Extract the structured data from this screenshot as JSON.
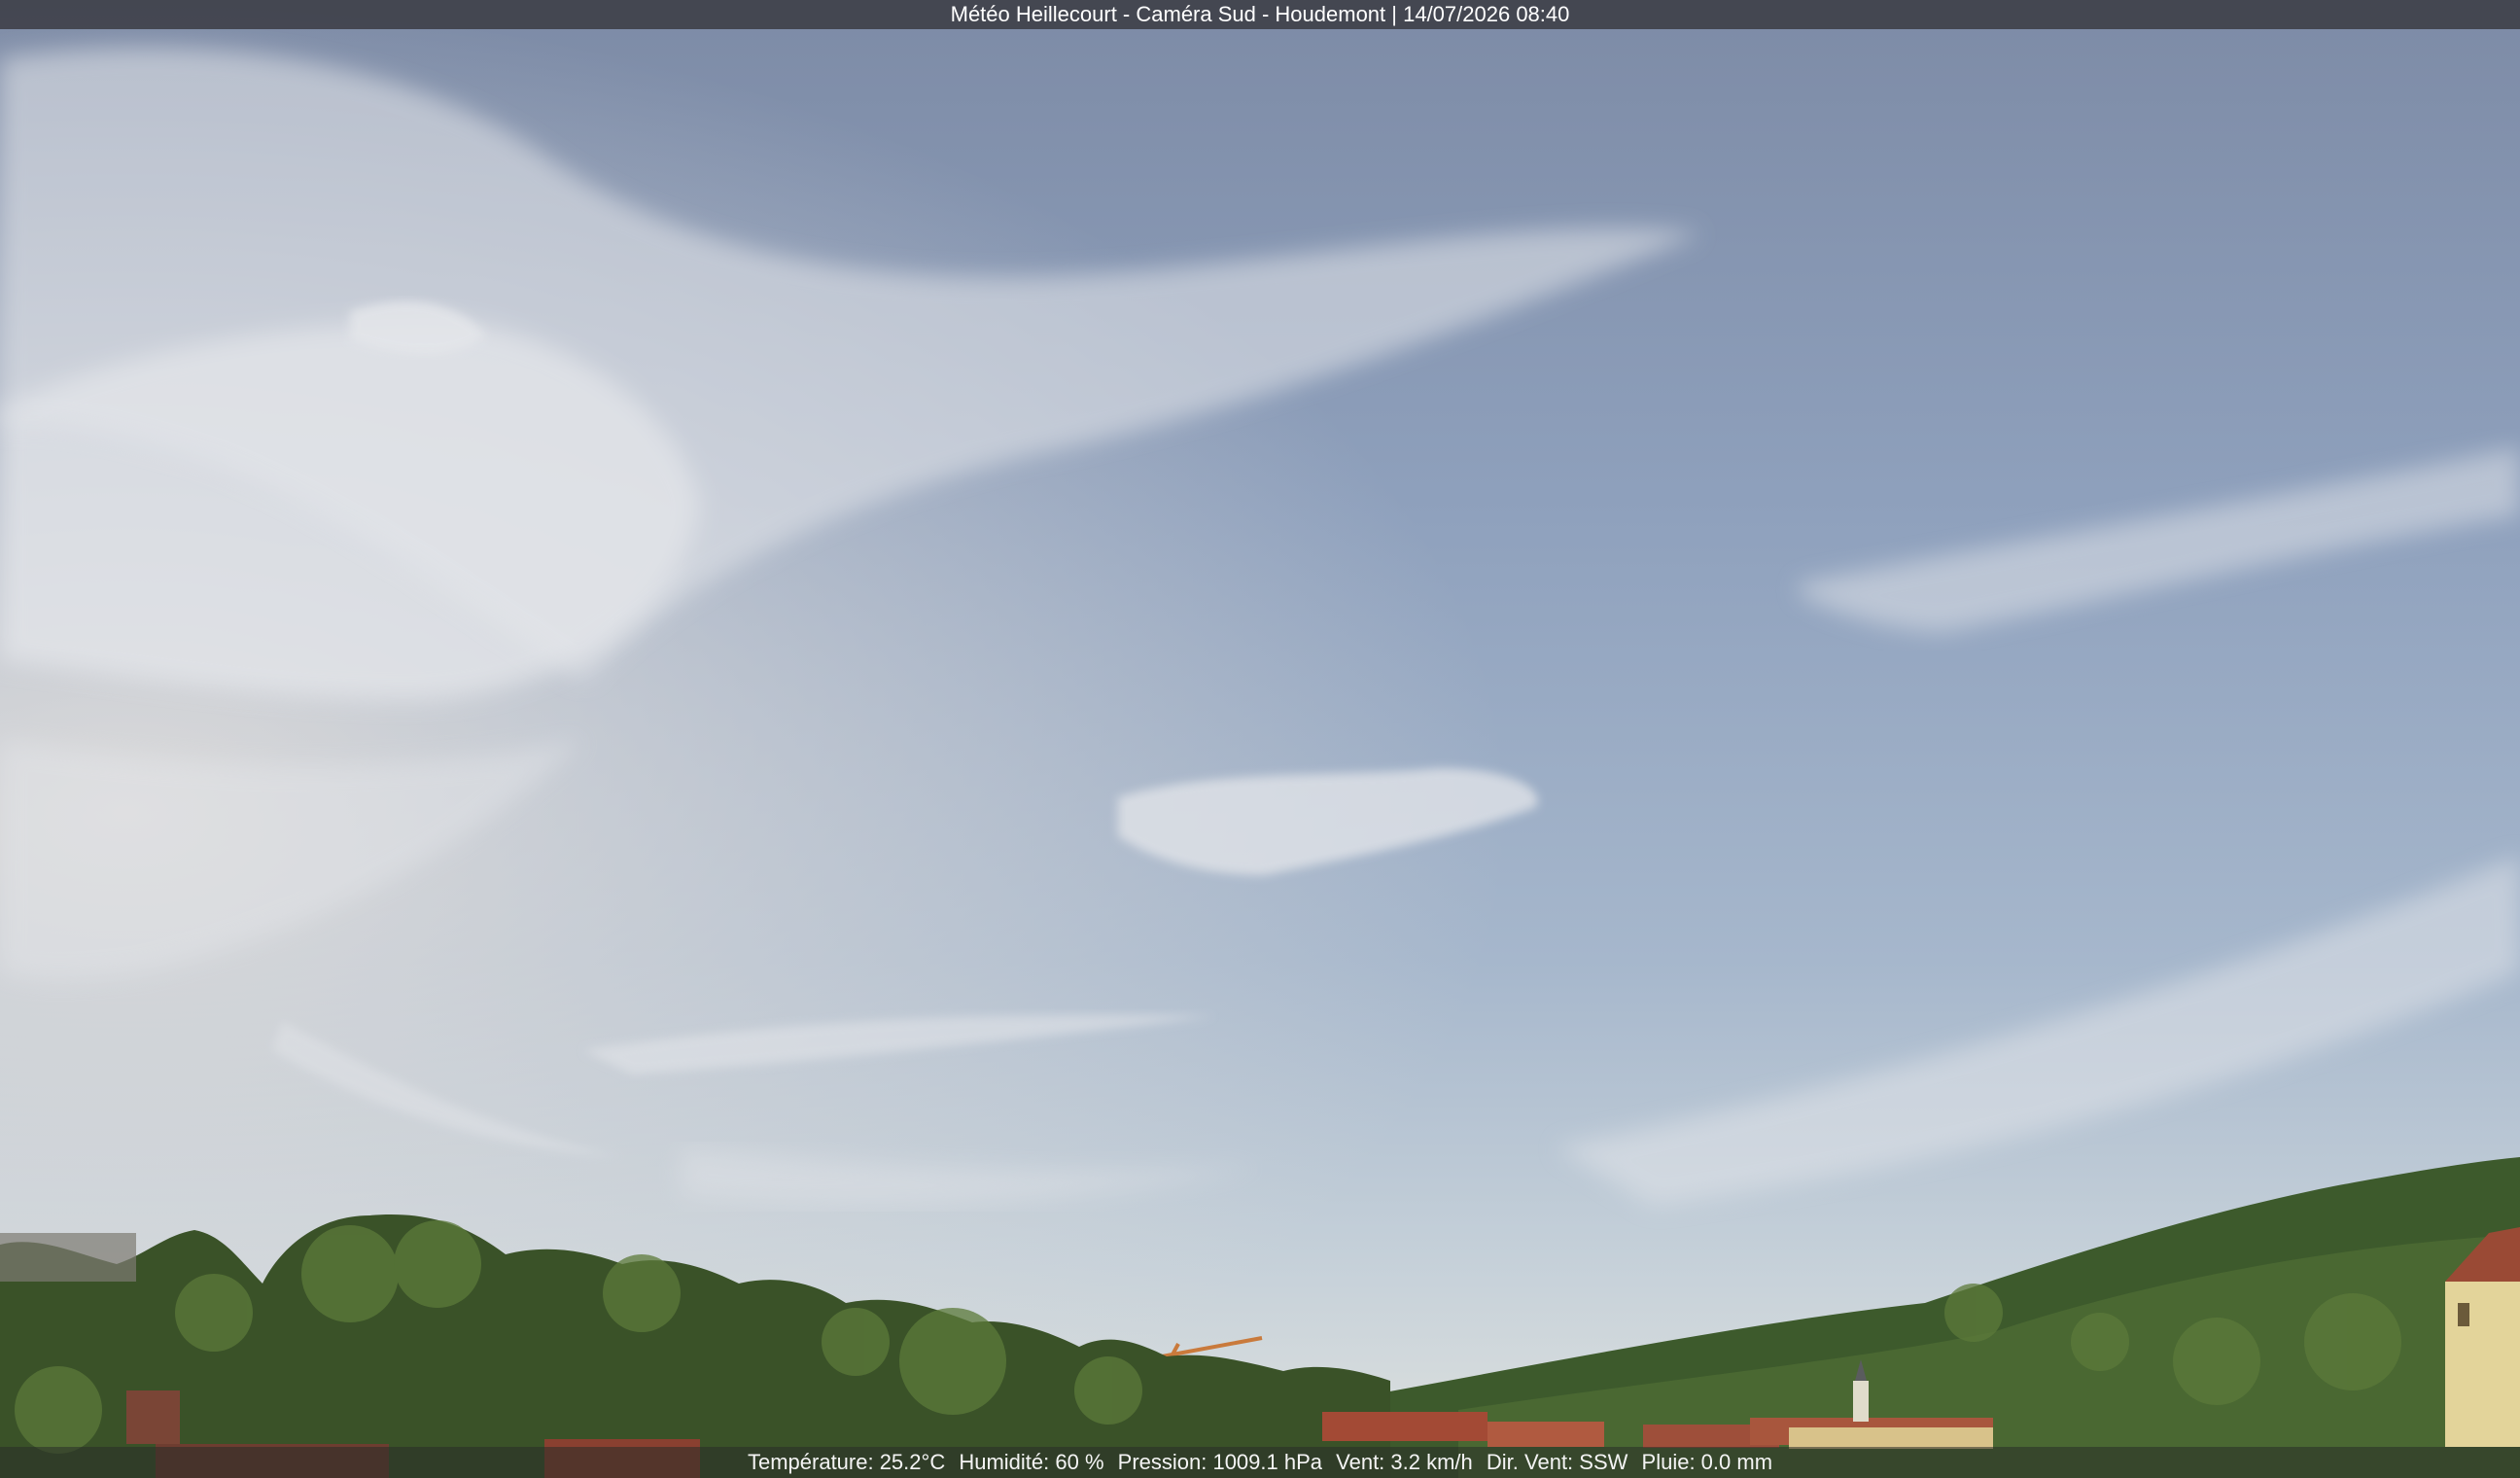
{
  "camera_title": "Météo Heillecourt - Caméra Sud - Houdemont | 14/07/2026 08:40",
  "weather": {
    "temperature": "Température: 25.2°C",
    "humidity": "Humidité: 60 %",
    "pressure": "Pression: 1009.1 hPa",
    "wind": "Vent: 3.2 km/h",
    "wind_dir": "Dir. Vent: SSW",
    "rain": "Pluie: 0.0 mm"
  },
  "colors": {
    "sky_top": "#7f8ea8",
    "sky_mid": "#98abc4",
    "sky_horizon": "#d9dde0",
    "foliage": "#3f5a2e",
    "roof": "#9a4a35"
  }
}
